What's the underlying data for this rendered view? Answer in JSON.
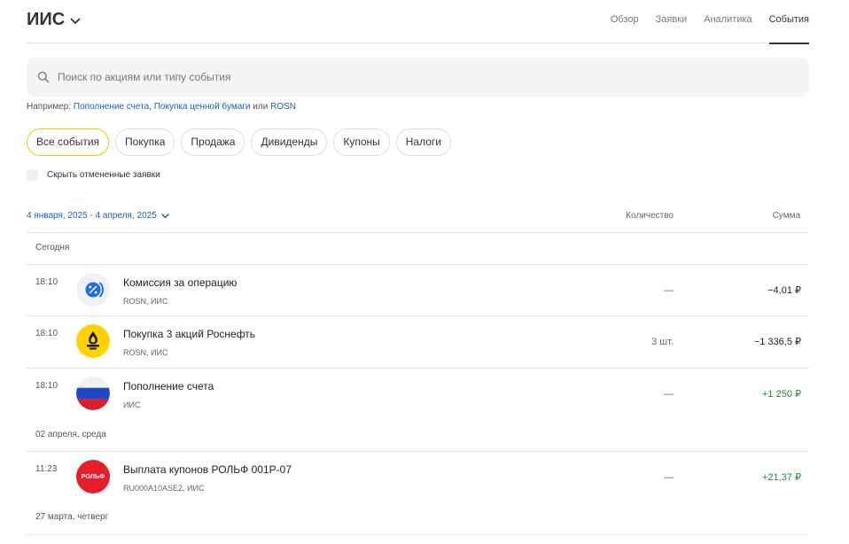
{
  "header": {
    "title": "ИИС",
    "tabs": [
      {
        "label": "Обзор"
      },
      {
        "label": "Заявки"
      },
      {
        "label": "Аналитика"
      },
      {
        "label": "События",
        "active": true
      }
    ]
  },
  "search": {
    "placeholder": "Поиск по акциям или типу события",
    "value": ""
  },
  "hint": {
    "prefix": "Например:",
    "link1": "Пополнение счета",
    "sep1": ",",
    "link2": "Покупка ценной бумаги",
    "or": "или",
    "link3": "ROSN"
  },
  "filters": [
    {
      "label": "Все события",
      "active": true
    },
    {
      "label": "Покупка"
    },
    {
      "label": "Продажа"
    },
    {
      "label": "Дивиденды"
    },
    {
      "label": "Купоны"
    },
    {
      "label": "Налоги"
    }
  ],
  "hide_cancelled": {
    "label": "Скрыть отмененные заявки",
    "checked": false
  },
  "table": {
    "date_range": "4 января, 2025 - 4 апреля, 2025",
    "col_qty": "Количество",
    "col_sum": "Сумма"
  },
  "groups": [
    {
      "label": "Сегодня",
      "rows": [
        {
          "time": "18:10",
          "name": "Комиссия за операцию",
          "sub": "ROSN, ИИС",
          "qty": "—",
          "sum": "−4,01 ₽",
          "logo": "percent-icon"
        },
        {
          "time": "18:10",
          "name": "Покупка 3 акций Роснефть",
          "sub": "ROSN, ИИС",
          "qty": "3 шт.",
          "sum": "−1 336,5 ₽",
          "logo": "rosneft-logo"
        },
        {
          "time": "18:10",
          "name": "Пополнение счета",
          "sub": "ИИС",
          "qty": "—",
          "sum": "+1 250 ₽",
          "logo": "russia-flag-icon"
        }
      ]
    },
    {
      "label": "02 апреля, среда",
      "rows": [
        {
          "time": "11:23",
          "name": "Выплата купонов РОЛЬФ 001P-07",
          "sub": "RU000A10ASE2, ИИС",
          "qty": "—",
          "sum": "+21,37 ₽",
          "logo": "rolf-logo",
          "logo_text": "РОЛЬФ"
        }
      ]
    },
    {
      "label": "27 марта, четверг",
      "rows": []
    }
  ],
  "colors": {
    "accent_link": "#1a5fbf",
    "positive": "#1b8a3a",
    "chip_active_border": "#f0c800",
    "rosneft_yellow": "#ffd200",
    "rolf_red": "#e41e2b"
  }
}
